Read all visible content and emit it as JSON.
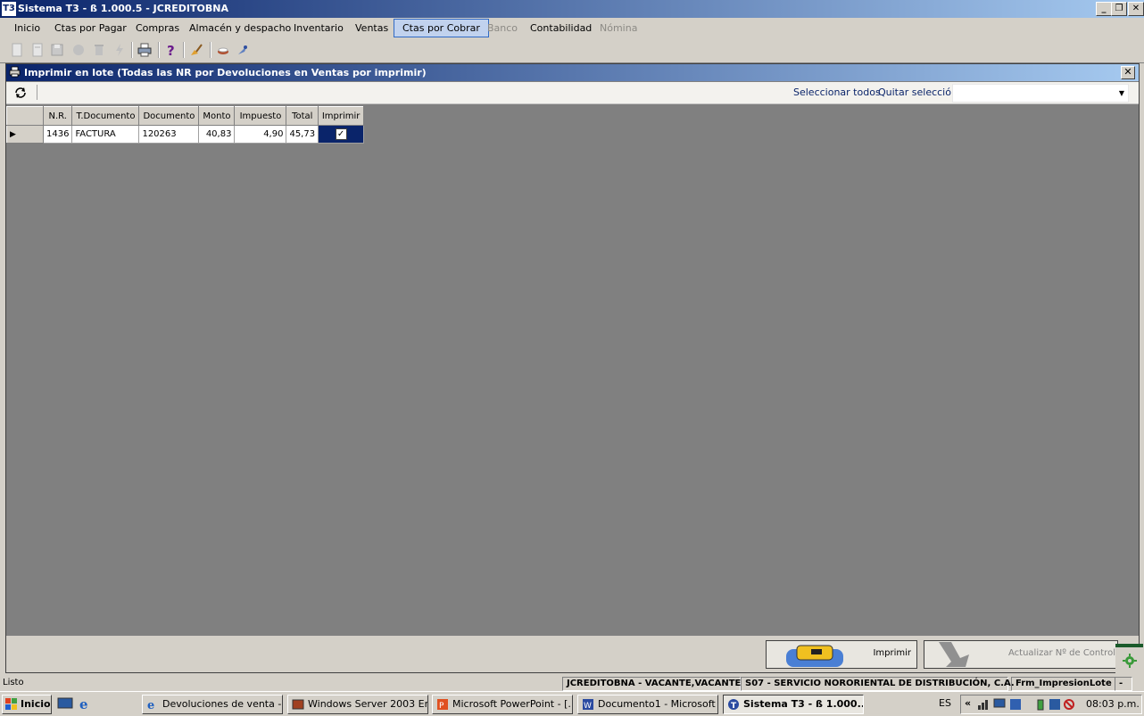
{
  "window": {
    "title": "Sistema T3 - ß 1.000.5 - JCREDITOBNA",
    "logo": "T3",
    "minimize_label": "_",
    "restore_label": "❐",
    "close_label": "✕"
  },
  "menu": [
    {
      "label": "Inicio",
      "state": "normal"
    },
    {
      "label": "Ctas por Pagar",
      "state": "normal"
    },
    {
      "label": "Compras",
      "state": "normal"
    },
    {
      "label": "Almacén y despacho",
      "state": "normal"
    },
    {
      "label": "Inventario",
      "state": "normal"
    },
    {
      "label": "Ventas",
      "state": "normal"
    },
    {
      "label": "Ctas por Cobrar",
      "state": "active"
    },
    {
      "label": "Banco",
      "state": "disabled"
    },
    {
      "label": "Contabilidad",
      "state": "normal"
    },
    {
      "label": "Nómina",
      "state": "disabled"
    }
  ],
  "toolbar_icons": [
    "new-icon",
    "open-icon",
    "save-icon",
    "record-icon",
    "delete-icon",
    "lightning-icon",
    "print-icon",
    "help-icon",
    "broom-icon",
    "coffee-icon",
    "rocket-icon"
  ],
  "child": {
    "title": "Imprimir en lote (Todas las NR por Devoluciones en Ventas por imprimir)",
    "close_label": "✕",
    "select_all": "Seleccionar todos",
    "clear_selection": "Quitar selección",
    "combo_value": ""
  },
  "grid": {
    "columns": [
      "N.R.",
      "T.Documento",
      "Documento",
      "Monto",
      "Impuesto",
      "Total",
      "Imprimir"
    ],
    "rows": [
      {
        "nr": "1436",
        "tdoc": "FACTURA",
        "doc": "120263",
        "monto": "40,83",
        "impuesto": "4,90",
        "total": "45,73",
        "imprimir": true
      }
    ]
  },
  "buttons": {
    "print": "Imprimir",
    "update_control": "Actualizar Nº de Control"
  },
  "status": {
    "left": "Listo",
    "user": "JCREDITOBNA - VACANTE,VACANTE",
    "company": "S07 - SERVICIO NORORIENTAL DE DISTRIBUCIÓN, C.A.",
    "form": "Frm_ImpresionLote",
    "extra": "-"
  },
  "taskbar": {
    "start": "Inicio",
    "tasks": [
      {
        "label": "Devoluciones de venta - ...",
        "icon": "ie-icon",
        "active": false
      },
      {
        "label": "Windows Server 2003 En...",
        "icon": "server-icon",
        "active": false
      },
      {
        "label": "Microsoft PowerPoint - [...",
        "icon": "powerpoint-icon",
        "active": false
      },
      {
        "label": "Documento1 - Microsoft ...",
        "icon": "word-icon",
        "active": false
      },
      {
        "label": "Sistema T3 - ß 1.000....",
        "icon": "t3-icon",
        "active": true
      }
    ],
    "lang": "ES",
    "clock": "08:03 p.m.",
    "tray_arrow": "«"
  }
}
